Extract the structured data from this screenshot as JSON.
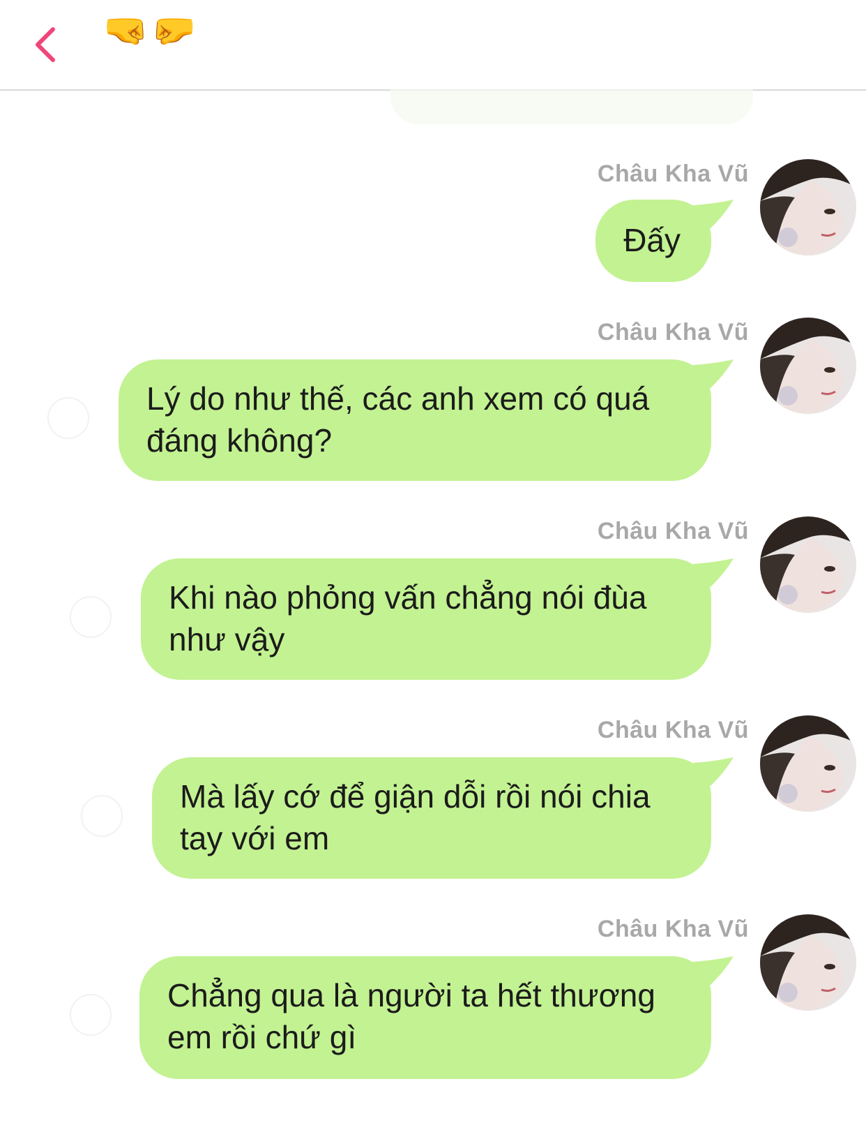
{
  "header": {
    "back_icon": "chevron-left-icon",
    "accent_color": "#f0457a",
    "title_emoji": "🤜🤛"
  },
  "messages": [
    {
      "sender": "Châu Kha Vũ",
      "text": "Đấy"
    },
    {
      "sender": "Châu Kha Vũ",
      "text": "Lý do như thế, các anh xem có quá\nđáng không?"
    },
    {
      "sender": "Châu Kha Vũ",
      "text": "Khi nào phỏng vấn chẳng nói đùa\nnhư vậy"
    },
    {
      "sender": "Châu Kha Vũ",
      "text": "Mà lấy cớ để giận dỗi rồi nói chia\ntay với em"
    },
    {
      "sender": "Châu Kha Vũ",
      "text": "Chẳng qua là người ta hết thương\nem rồi chứ gì"
    }
  ],
  "colors": {
    "bubble": "#c3f292",
    "sender_name": "#a8a8a8",
    "text": "#1b1b1b"
  }
}
